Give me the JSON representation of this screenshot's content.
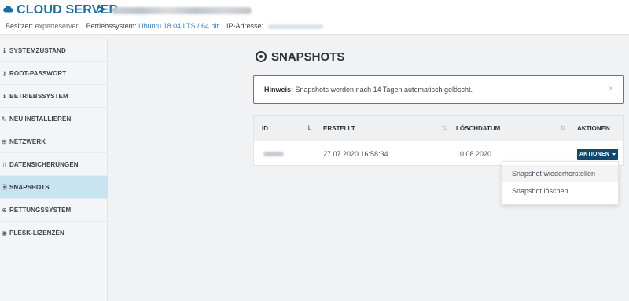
{
  "header": {
    "title": "CLOUD SERVER",
    "chevron": ">",
    "owner_label": "Besitzer:",
    "owner_value": "experteserver",
    "os_label": "Betriebssystem:",
    "os_value": "Ubuntu 18.04 LTS / 64 bit",
    "ip_label": "IP-Adresse:"
  },
  "sidebar": {
    "items": [
      {
        "label": "SYSTEMZUSTAND",
        "icon": "info-icon"
      },
      {
        "label": "ROOT-PASSWORT",
        "icon": "key-icon"
      },
      {
        "label": "BETRIEBSSYSTEM",
        "icon": "info-icon"
      },
      {
        "label": "NEU INSTALLIEREN",
        "icon": "refresh-icon"
      },
      {
        "label": "NETZWERK",
        "icon": "network-icon"
      },
      {
        "label": "DATENSICHERUNGEN",
        "icon": "file-icon"
      },
      {
        "label": "SNAPSHOTS",
        "icon": "snapshot-icon",
        "active": true
      },
      {
        "label": "RETTUNGSSYSTEM",
        "icon": "lifebuoy-icon"
      },
      {
        "label": "PLESK-LIZENZEN",
        "icon": "plesk-icon"
      }
    ]
  },
  "main": {
    "title": "SNAPSHOTS",
    "alert": {
      "strong": "Hinweis:",
      "text": " Snapshots werden nach 14 Tagen automatisch gelöscht.",
      "close": "×"
    },
    "table": {
      "headers": {
        "id": "ID",
        "created": "ERSTELLT",
        "delete_date": "LÖSCHDATUM",
        "actions": "AKTIONEN"
      },
      "rows": [
        {
          "created": "27.07.2020 16:58:34",
          "delete_date": "10.08.2020"
        }
      ],
      "action_button": "AKTIONEN"
    },
    "dropdown": {
      "items": [
        "Snapshot wiederherstellen",
        "Snapshot löschen"
      ]
    }
  },
  "colors": {
    "brand": "#1a6fa8",
    "alert_border": "#d9454d",
    "action_button": "#0c4a6e",
    "active_nav": "#c9e4f1"
  }
}
